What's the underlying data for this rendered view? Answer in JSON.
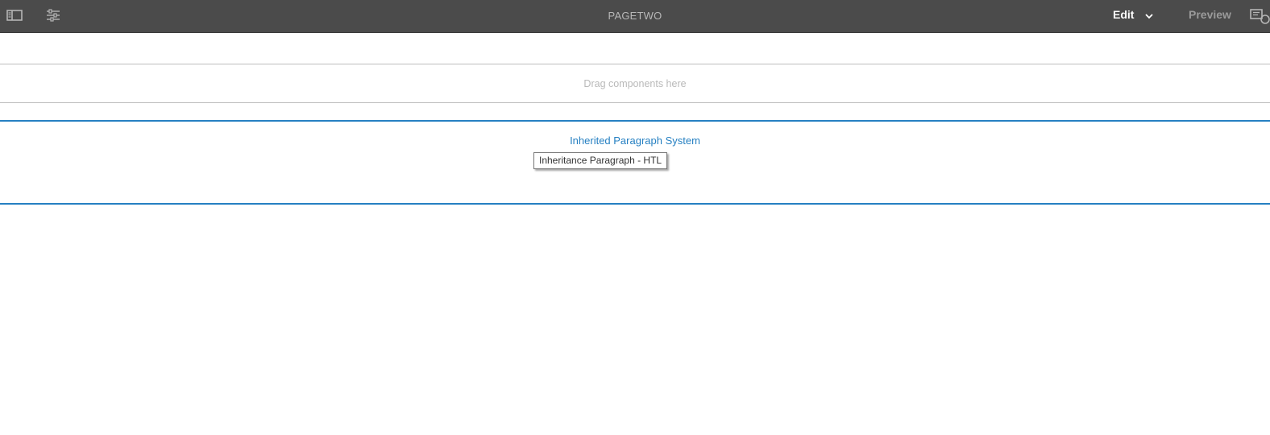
{
  "header": {
    "page_title": "PAGETWO",
    "side_panel_icon": "side-panel-icon",
    "properties_icon": "sliders-icon",
    "edit_label": "Edit",
    "mode_dropdown_icon": "chevron-down-icon",
    "preview_label": "Preview",
    "annotations_icon": "annotations-icon"
  },
  "main": {
    "drop_placeholder": "Drag components here",
    "inherited_paragraph_title": "Inherited Paragraph System",
    "tooltip_text": "Inheritance Paragraph - HTL"
  },
  "colors": {
    "toolbar_bg": "#4b4b4b",
    "accent_blue": "#2680c2",
    "placeholder_text": "#b9b9b9"
  }
}
